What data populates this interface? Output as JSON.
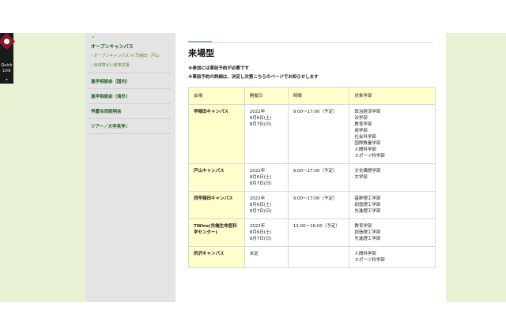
{
  "quick_link": {
    "label_line1": "Quick",
    "label_line2": "Link",
    "arrow": "▾"
  },
  "sidebar": {
    "chevron": "⌄",
    "heading": "オープンキャンパス",
    "sub_items": [
      "› オープンキャンパス in 早稲田・戸山",
      "› 身体障がい者等支援"
    ],
    "items": [
      "進学相談会（国内）",
      "進学相談会（海外）",
      "早慶合同説明会",
      "ツアー／大学見学♪"
    ]
  },
  "main": {
    "title": "来場型",
    "notes": [
      "※参加には事前予約が必要です",
      "※事前予約の詳細は、決定し次第こちらのページでお知らせします"
    ],
    "table": {
      "headers": [
        "会場",
        "開催日",
        "時間",
        "対象学部"
      ],
      "rows": [
        {
          "campus": "早稲田キャンパス",
          "dates": [
            "2022年",
            "8月6日(土)",
            "8月7日(日)"
          ],
          "time": "9:00～17:00（予定）",
          "faculties": [
            "政治経済学部",
            "法学部",
            "教育学部",
            "商学部",
            "社会科学部",
            "国際教養学部",
            "人間科学部",
            "スポーツ科学部"
          ]
        },
        {
          "campus": "戸山キャンパス",
          "dates": [
            "2022年",
            "8月6日(土)",
            "8月7日(日)"
          ],
          "time": "9:00～17:00（予定）",
          "faculties": [
            "文化構想学部",
            "文学部"
          ]
        },
        {
          "campus": "西早稲田キャンパス",
          "dates": [
            "2022年",
            "8月6日(土)",
            "8月7日(日)"
          ],
          "time": "9:00～17:00（予定）",
          "faculties": [
            "基幹理工学部",
            "創造理工学部",
            "先進理工学部"
          ]
        },
        {
          "campus": "TWIns(先端生命医科学センター)",
          "dates": [
            "2022年",
            "8月6日(土)",
            "8月7日(日)"
          ],
          "time": "13:00～16:00（予定）",
          "faculties": [
            "教育学部",
            "創造理工学部",
            "先進理工学部"
          ]
        },
        {
          "campus": "所沢キャンパス",
          "dates": [
            "未定"
          ],
          "time": "",
          "faculties": [
            "人間科学部",
            "スポーツ科学部"
          ]
        }
      ]
    }
  },
  "colors": {
    "side_green": "#e6f2d3",
    "sidebar_gray": "#e4e4e4",
    "table_highlight": "#ffffcc",
    "link_green": "#1f5e1f"
  }
}
